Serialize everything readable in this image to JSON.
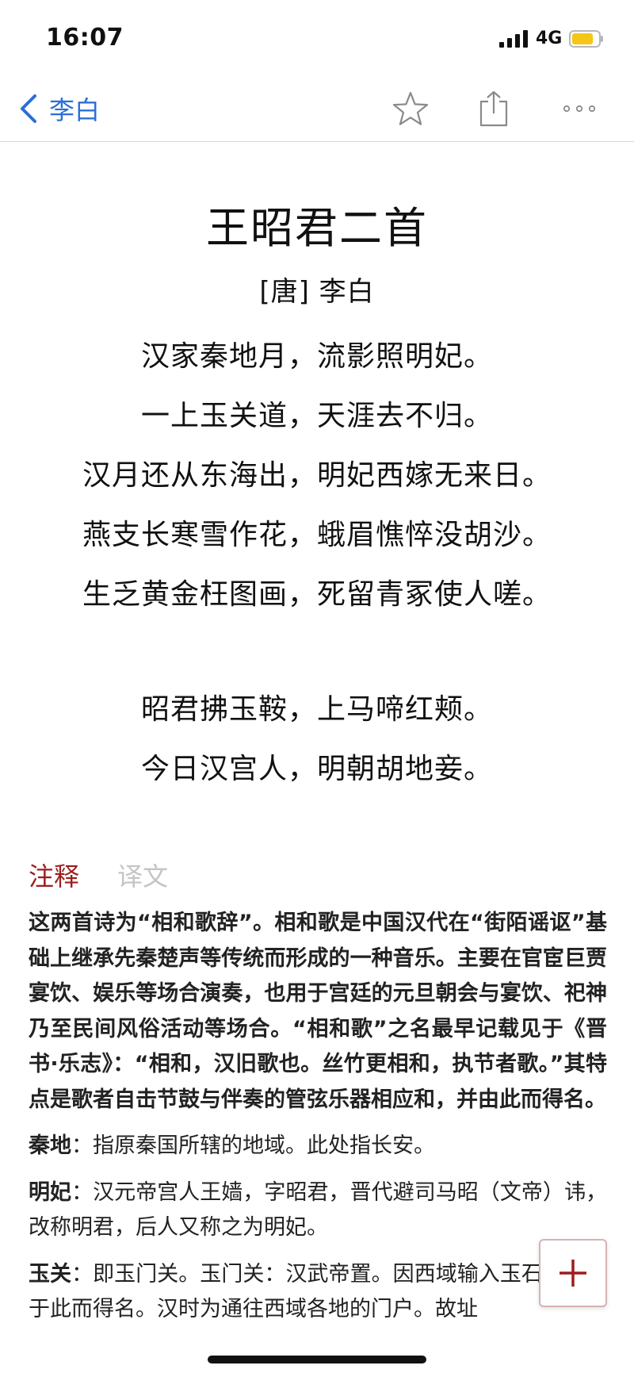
{
  "status": {
    "time": "16:07",
    "network": "4G"
  },
  "nav": {
    "back_label": "李白"
  },
  "poem": {
    "title": "王昭君二首",
    "author": "[唐] 李白",
    "stanzas": [
      [
        "汉家秦地月，流影照明妃。",
        "一上玉关道，天涯去不归。",
        "汉月还从东海出，明妃西嫁无来日。",
        "燕支长寒雪作花，蛾眉憔悴没胡沙。",
        "生乏黄金枉图画，死留青冢使人嗟。"
      ],
      [
        "昭君拂玉鞍，上马啼红颊。",
        "今日汉宫人，明朝胡地妾。"
      ]
    ]
  },
  "tabs": {
    "notes": "注释",
    "translation": "译文"
  },
  "notes": {
    "intro": "这两首诗为“相和歌辞”。相和歌是中国汉代在“街陌谣讴”基础上继承先秦楚声等传统而形成的一种音乐。主要在官宦巨贾宴饮、娱乐等场合演奏，也用于宫廷的元旦朝会与宴饮、祀神乃至民间风俗活动等场合。“相和歌”之名最早记载见于《晋书·乐志》：“相和，汉旧歌也。丝竹更相和，执节者歌。”其特点是歌者自击节鼓与伴奏的管弦乐器相应和，并由此而得名。",
    "items": [
      {
        "term": "秦地",
        "text": "：指原秦国所辖的地域。此处指长安。"
      },
      {
        "term": "明妃",
        "text": "：汉元帝宫人王嫱，字昭君，晋代避司马昭（文帝）讳，改称明君，后人又称之为明妃。"
      },
      {
        "term": "玉关",
        "text": "：即玉门关。玉门关：汉武帝置。因西域输入玉石时取道于此而得名。汉时为通往西域各地的门户。故址"
      }
    ]
  },
  "colors": {
    "accent": "#9b1e1e",
    "link": "#2b6fd6",
    "battery": "#f5c518"
  },
  "icons": [
    "back-chevron-icon",
    "star-icon",
    "share-icon",
    "more-icon",
    "plus-icon"
  ]
}
